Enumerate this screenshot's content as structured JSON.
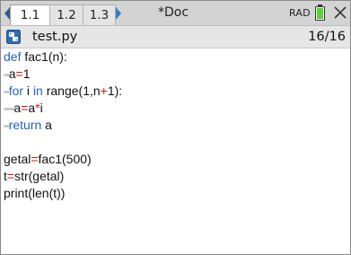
{
  "tabs": [
    "1.1",
    "1.2",
    "1.3"
  ],
  "doc_title": "*Doc",
  "angle_mode": "RAD",
  "file": {
    "name": "test.py",
    "line_info": "16/16"
  },
  "code": {
    "l1_def": "def",
    "l1_rest": " fac1(n):",
    "l2_indent": "••",
    "l2_a": "a",
    "l2_eq": "=",
    "l2_val": "1",
    "l3_indent": "••",
    "l3_for": "for",
    "l3_i": " i ",
    "l3_in": "in",
    "l3_range": " range(1,n",
    "l3_plus": "+",
    "l3_end": "1):",
    "l4_indent": "••••",
    "l4_a": "a",
    "l4_eq": "=",
    "l4_a2": "a",
    "l4_mul": "*",
    "l4_i": "i",
    "l5_indent": "••",
    "l5_return": "return",
    "l5_a": " a",
    "l7_getal": "getal",
    "l7_eq": "=",
    "l7_rest": "fac1(500)",
    "l8_t": "t",
    "l8_eq": "=",
    "l8_rest": "str(getal)",
    "l9": "print(len(t))"
  },
  "colors": {
    "keyword": "#1f62c9",
    "operator": "#d01818",
    "battery": "#5cd13a"
  },
  "icons": [
    "arrow-left-icon",
    "arrow-right-icon",
    "battery-icon",
    "close-icon",
    "python-file-icon"
  ]
}
